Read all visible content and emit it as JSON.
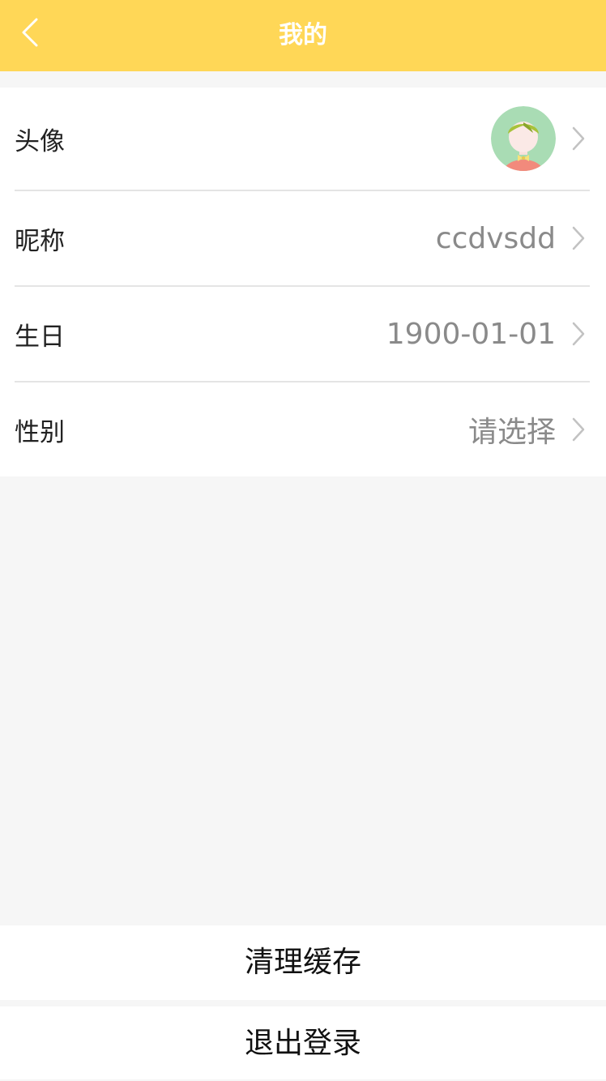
{
  "header": {
    "title": "我的",
    "back_icon": "back-chevron-icon",
    "background_color": "#ffd757"
  },
  "profile": {
    "avatar": {
      "label": "头像",
      "image": "avatar-girl-icon"
    },
    "nickname": {
      "label": "昵称",
      "value": "ccdvsdd"
    },
    "birthday": {
      "label": "生日",
      "value": "1900-01-01"
    },
    "gender": {
      "label": "性别",
      "value": "请选择"
    }
  },
  "actions": {
    "clear_cache_label": "清理缓存",
    "logout_label": "退出登录"
  },
  "colors": {
    "page_background": "#f6f6f6",
    "value_text": "#8a8a8a",
    "divider": "#e4e4e4"
  }
}
